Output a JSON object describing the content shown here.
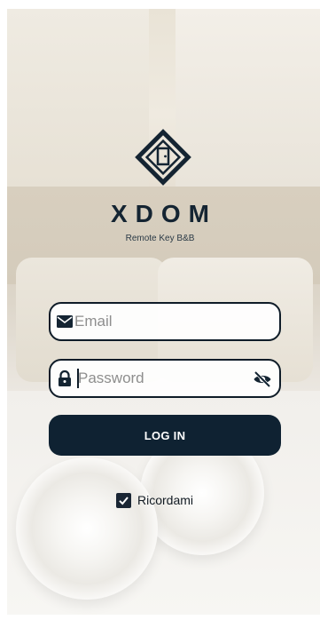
{
  "brand": {
    "name": "XDOM",
    "tagline": "Remote Key B&B",
    "logo_icon": "door-diamond-icon"
  },
  "form": {
    "email": {
      "placeholder": "Email",
      "value": "",
      "icon": "envelope-icon"
    },
    "password": {
      "placeholder": "Password",
      "value": "",
      "icon": "lock-icon",
      "toggle_icon": "eye-off-icon"
    },
    "login_label": "LOG IN",
    "remember": {
      "label": "Ricordami",
      "checked": true
    }
  },
  "colors": {
    "primary": "#0f2232",
    "field_border": "#0f1c28",
    "placeholder": "#8e8e8e"
  }
}
